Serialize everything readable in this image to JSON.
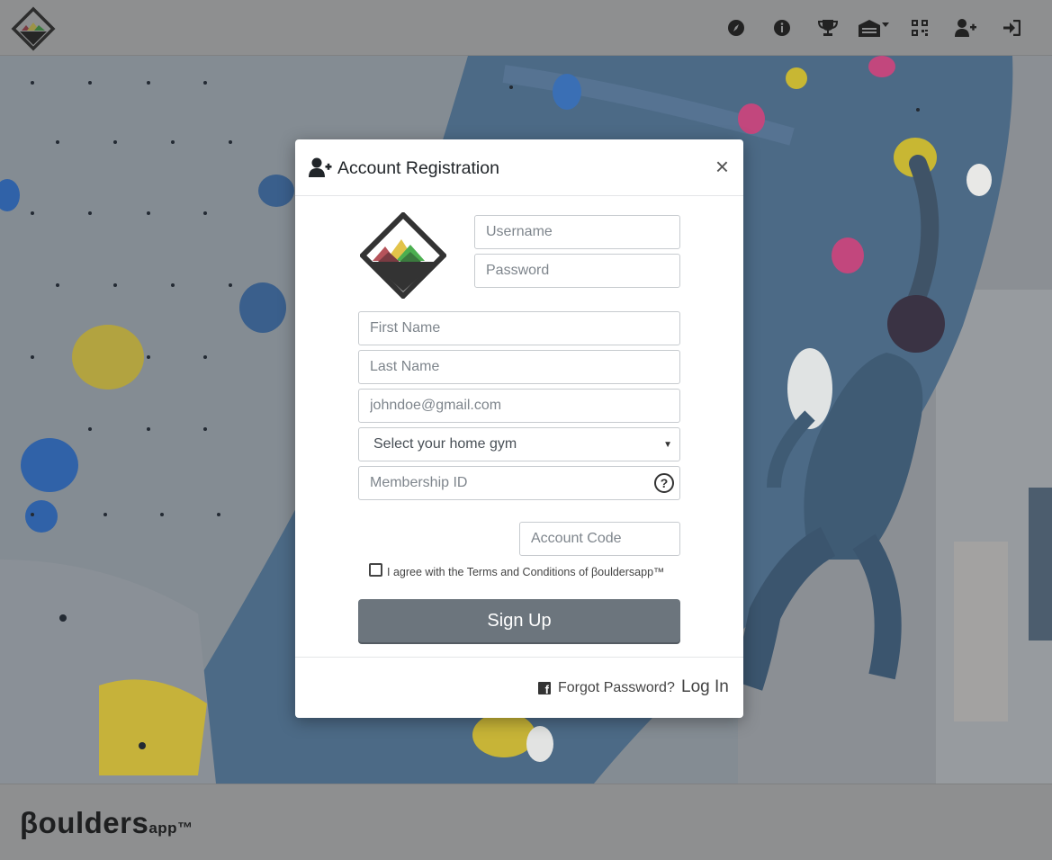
{
  "navbar": {
    "logo_icon": "boulders-logo",
    "icons": [
      "compass-icon",
      "info-icon",
      "trophy-icon",
      "gym-dropdown-icon",
      "qr-code-icon",
      "user-plus-icon",
      "sign-in-icon"
    ]
  },
  "modal": {
    "title": "Account Registration",
    "title_icon": "user-plus-icon",
    "close_label": "×",
    "fields": {
      "username_placeholder": "Username",
      "password_placeholder": "Password",
      "first_name_placeholder": "First Name",
      "last_name_placeholder": "Last Name",
      "email_placeholder": "johndoe@gmail.com",
      "home_gym_selected": "Select your home gym",
      "membership_placeholder": "Membership ID",
      "account_code_placeholder": "Account Code"
    },
    "help_label": "?",
    "terms_label": "I agree with the Terms and Conditions of βouldersapp™",
    "signup_label": "Sign Up",
    "footer": {
      "facebook_icon": "facebook-icon",
      "forgot_label": "Forgot Password?",
      "login_label": "Log In"
    }
  },
  "footer": {
    "brand_main": "βoulders",
    "brand_sub": "app™"
  },
  "colors": {
    "overlay": "#8e8f90",
    "button": "#6c757d",
    "logo_red": "#b5535a",
    "logo_yellow": "#e2c34a",
    "logo_green": "#4caf50",
    "logo_dark": "#333333"
  }
}
